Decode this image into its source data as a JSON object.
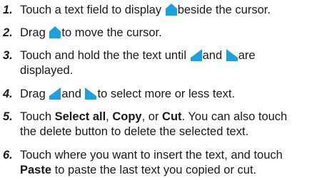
{
  "accent_color": "#1ea0de",
  "steps": [
    {
      "number": "1.",
      "text_a": "Touch a text field to display ",
      "icon": "cursor-handle-center-icon",
      "text_b": "beside the cursor."
    },
    {
      "number": "2.",
      "text_a": "Drag ",
      "icon": "cursor-handle-center-icon",
      "text_b": "to move the cursor."
    },
    {
      "number": "3.",
      "text_a": "Touch and hold the the text until ",
      "icon_left": "selection-handle-left-icon",
      "text_b": "and ",
      "icon_right": "selection-handle-right-icon",
      "text_c": "are",
      "text_d": "displayed."
    },
    {
      "number": "4.",
      "text_a": "Drag ",
      "icon_left": "selection-handle-left-icon",
      "text_b": "and ",
      "icon_right": "selection-handle-right-icon",
      "text_c": "to select more or less text."
    },
    {
      "number": "5.",
      "text_a": "Touch ",
      "bold_a": "Select all",
      "text_b": ", ",
      "bold_b": "Copy",
      "text_c": ", or ",
      "bold_c": "Cut",
      "text_d": ". You can also touch",
      "text_e": "the delete button to delete the selected text."
    },
    {
      "number": "6.",
      "text_a": "Touch where you want to insert the text, and touch",
      "bold_a": "Paste",
      "text_b": " to paste the last text you copied or cut."
    }
  ]
}
